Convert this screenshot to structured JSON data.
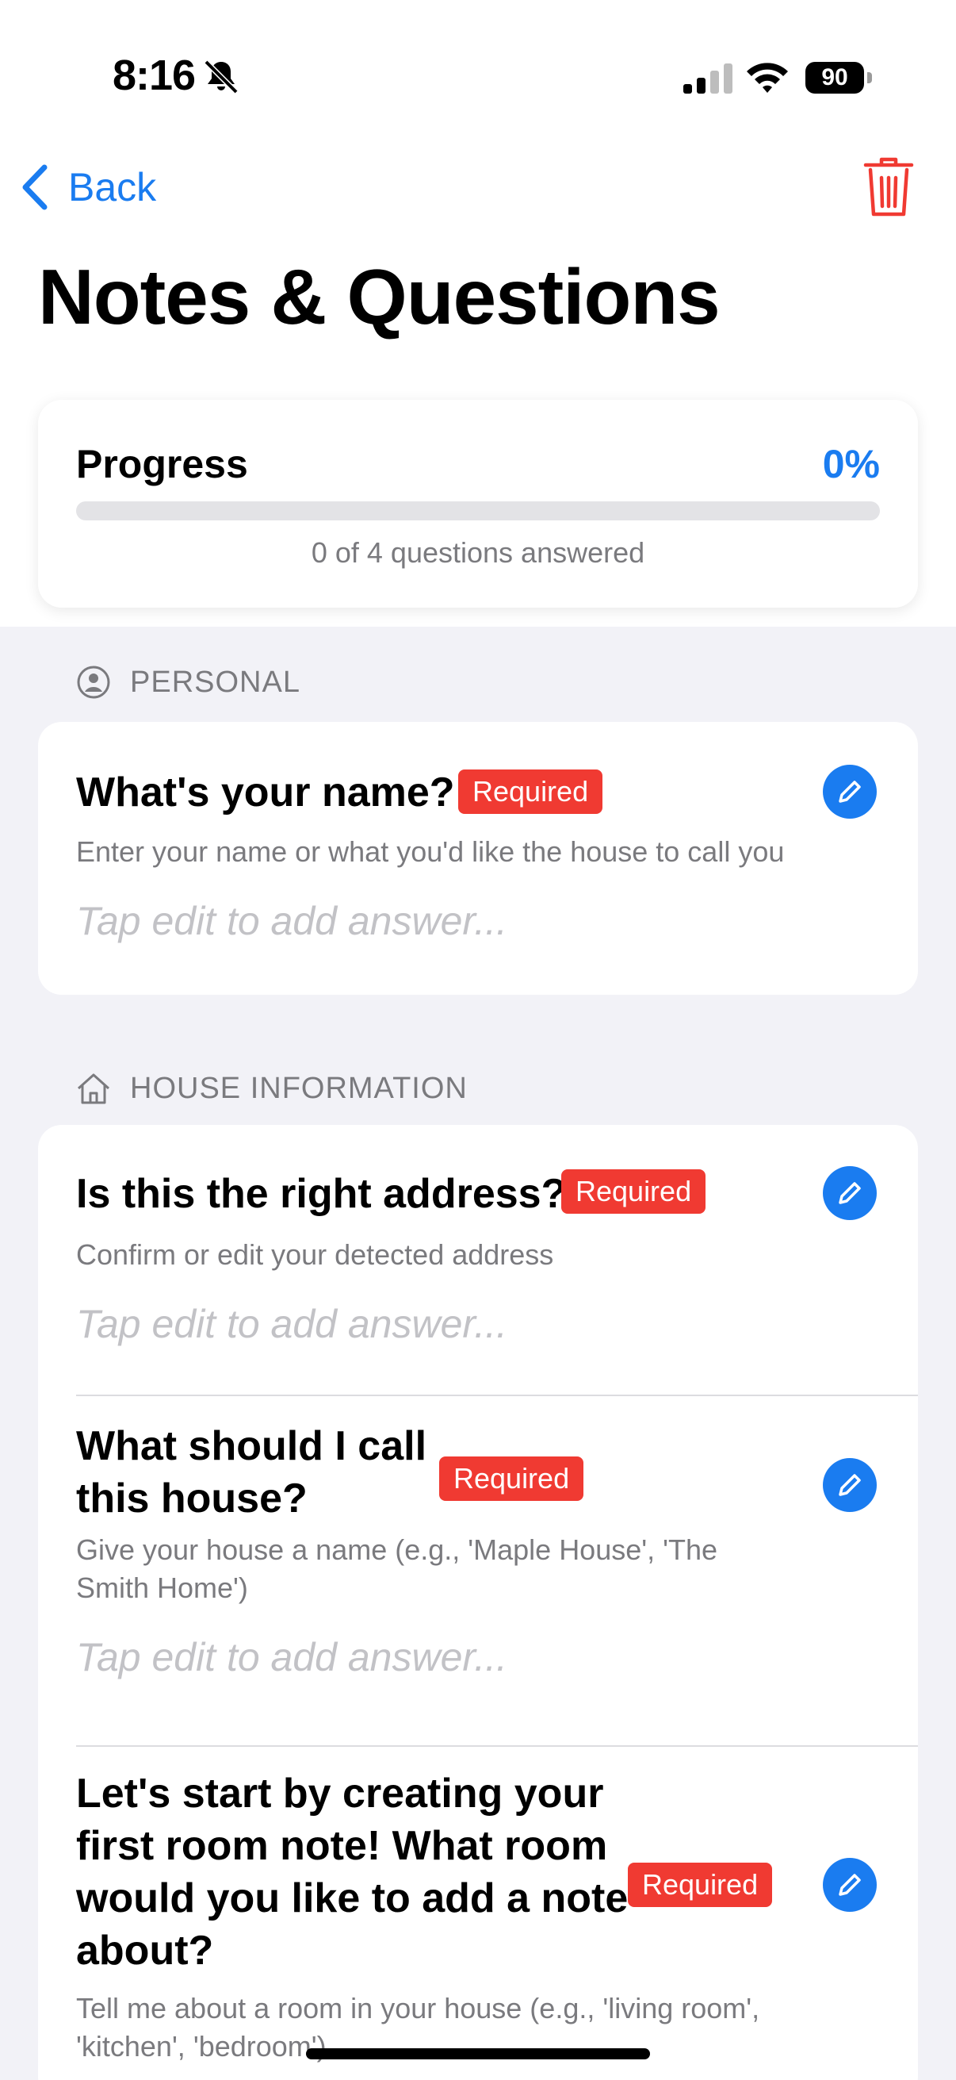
{
  "status_bar": {
    "time": "8:16",
    "battery": "90"
  },
  "nav": {
    "back_label": "Back"
  },
  "page_title": "Notes & Questions",
  "progress": {
    "label": "Progress",
    "percent_text": "0%",
    "fraction": 0,
    "caption": "0 of 4 questions answered"
  },
  "sections": [
    {
      "icon": "person-circle-icon",
      "title": "PERSONAL",
      "questions": [
        {
          "title": "What's your name?",
          "badge": "Required",
          "hint": "Enter your name or what you'd like the house to call you",
          "answer_placeholder": "Tap edit to add answer..."
        }
      ]
    },
    {
      "icon": "house-icon",
      "title": "HOUSE INFORMATION",
      "questions": [
        {
          "title": "Is this the right address?",
          "badge": "Required",
          "hint": "Confirm or edit your detected address",
          "answer_placeholder": "Tap edit to add answer..."
        },
        {
          "title_lines": [
            "What should I call",
            "this house?"
          ],
          "badge": "Required",
          "hint_lines": [
            "Give your house a name (e.g., 'Maple House', 'The",
            "Smith Home')"
          ],
          "answer_placeholder": "Tap edit to add answer..."
        },
        {
          "title_lines": [
            "Let's start by creating your",
            "first room note! What room",
            "would you like to add a note",
            "about?"
          ],
          "badge": "Required",
          "hint_lines": [
            "Tell me about a room in your house (e.g., 'living room',",
            "'kitchen', 'bedroom')"
          ]
        }
      ]
    }
  ],
  "colors": {
    "accent": "#1a7cf0",
    "required_badge": "#f03a32",
    "background": "#f2f2f7"
  }
}
